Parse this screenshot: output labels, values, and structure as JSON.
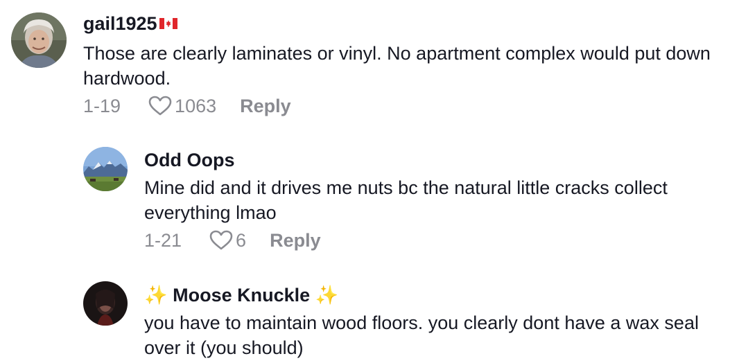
{
  "comments": [
    {
      "username": "gail1925",
      "flag": "canada-flag-icon",
      "text": "Those are clearly laminates or vinyl. No apartment complex would put down hardwood.",
      "date": "1-19",
      "likes": "1063",
      "reply_label": "Reply"
    },
    {
      "username": "Odd Oops",
      "text": "Mine did and it drives me nuts bc the natural little cracks collect everything lmao",
      "date": "1-21",
      "likes": "6",
      "reply_label": "Reply"
    },
    {
      "username_prefix": "✨",
      "username": "Moose Knuckle",
      "username_suffix": "✨",
      "text": "you have to maintain wood floors. you clearly dont have a wax seal over it (you should)"
    }
  ],
  "colors": {
    "text": "#161823",
    "muted": "#8a8b91",
    "background": "#ffffff"
  }
}
